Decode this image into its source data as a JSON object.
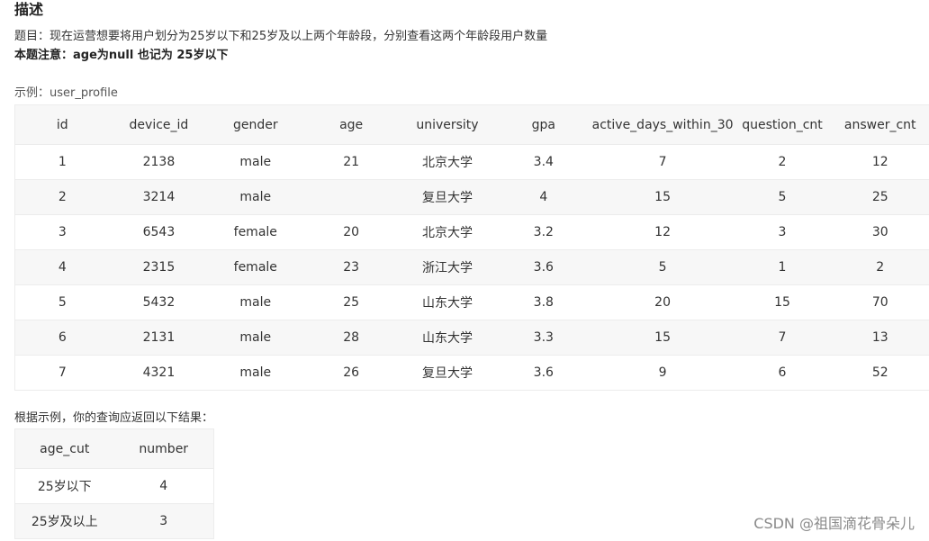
{
  "heading": "描述",
  "problem": "题目：现在运营想要将用户划分为25岁以下和25岁及以上两个年龄段，分别查看这两个年龄段用户数量",
  "note": "本题注意：age为null 也记为 25岁以下",
  "example_label": "示例：user_profile",
  "profile_table": {
    "columns": [
      "id",
      "device_id",
      "gender",
      "age",
      "university",
      "gpa",
      "active_days_within_30",
      "question_cnt",
      "answer_cnt"
    ],
    "rows": [
      [
        "1",
        "2138",
        "male",
        "21",
        "北京大学",
        "3.4",
        "7",
        "2",
        "12"
      ],
      [
        "2",
        "3214",
        "male",
        "",
        "复旦大学",
        "4",
        "15",
        "5",
        "25"
      ],
      [
        "3",
        "6543",
        "female",
        "20",
        "北京大学",
        "3.2",
        "12",
        "3",
        "30"
      ],
      [
        "4",
        "2315",
        "female",
        "23",
        "浙江大学",
        "3.6",
        "5",
        "1",
        "2"
      ],
      [
        "5",
        "5432",
        "male",
        "25",
        "山东大学",
        "3.8",
        "20",
        "15",
        "70"
      ],
      [
        "6",
        "2131",
        "male",
        "28",
        "山东大学",
        "3.3",
        "15",
        "7",
        "13"
      ],
      [
        "7",
        "4321",
        "male",
        "26",
        "复旦大学",
        "3.6",
        "9",
        "6",
        "52"
      ]
    ]
  },
  "result_label": "根据示例，你的查询应返回以下结果：",
  "result_table": {
    "columns": [
      "age_cut",
      "number"
    ],
    "rows": [
      [
        "25岁以下",
        "4"
      ],
      [
        "25岁及以上",
        "3"
      ]
    ]
  },
  "watermark": "CSDN @祖国滴花骨朵儿"
}
